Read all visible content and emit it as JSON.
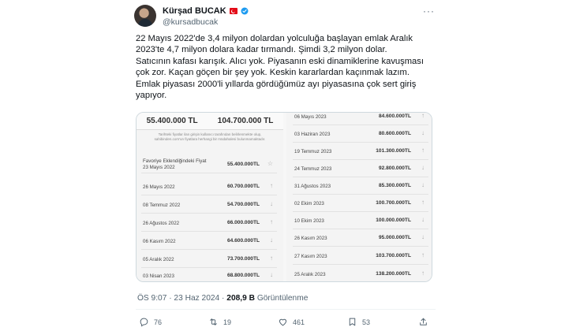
{
  "author": {
    "name": "Kürşad BUCAK",
    "handle": "@kursadbucak"
  },
  "tweet": {
    "lines": [
      "22 Mayıs 2022'de 3,4 milyon dolardan yolculuğa başlayan emlak Aralık",
      "2023'te 4,7 milyon dolara kadar tırmandı. Şimdi 3,2 milyon dolar.",
      "Satıcının kafası karışık. Alıcı yok. Piyasanın eski dinamiklerine kavuşması",
      "çok zor. Kaçan göçen bir şey yok. Keskin kararlardan kaçınmak lazım.",
      "Emlak piyasası 2000'li yıllarda gördüğümüz ayı piyasasına çok sert giriş",
      "yapıyor."
    ]
  },
  "media": {
    "left": {
      "price_current": "55.400.000 TL",
      "price_peak": "104.700.000 TL",
      "note": "Tarihteki fiyatlar ilan girişin kullanıcı tarafından belirlenmekte olup,\nsahibinden.com'un fiyatlara herhangi bir müdahalesi bulunmamaktadır.",
      "rows": [
        {
          "date": "Favoriye Eklendiğindeki Fiyat",
          "date2": "23 Mayıs 2022",
          "value": "55.400.000TL",
          "arrow": "☆"
        },
        {
          "date": "26 Mayıs 2022",
          "value": "60.700.000TL",
          "arrow": "↑"
        },
        {
          "date": "08 Temmuz 2022",
          "value": "54.700.000TL",
          "arrow": "↓"
        },
        {
          "date": "26 Ağustos 2022",
          "value": "66.000.000TL",
          "arrow": "↑"
        },
        {
          "date": "06 Kasım 2022",
          "value": "64.600.000TL",
          "arrow": "↓"
        },
        {
          "date": "05 Aralık 2022",
          "value": "73.700.000TL",
          "arrow": "↑"
        },
        {
          "date": "03 Nisan 2023",
          "value": "68.800.000TL",
          "arrow": "↓"
        }
      ]
    },
    "right": {
      "rows": [
        {
          "date": "06 Mayıs 2023",
          "value": "84.600.000TL",
          "arrow": "↑"
        },
        {
          "date": "03 Haziran 2023",
          "value": "80.600.000TL",
          "arrow": "↓"
        },
        {
          "date": "19 Temmuz 2023",
          "value": "101.300.000TL",
          "arrow": "↑"
        },
        {
          "date": "24 Temmuz 2023",
          "value": "92.800.000TL",
          "arrow": "↓"
        },
        {
          "date": "31 Ağustos 2023",
          "value": "85.300.000TL",
          "arrow": "↓"
        },
        {
          "date": "02 Ekim 2023",
          "value": "100.700.000TL",
          "arrow": "↑"
        },
        {
          "date": "10 Ekim 2023",
          "value": "100.000.000TL",
          "arrow": "↓"
        },
        {
          "date": "26 Kasım 2023",
          "value": "95.000.000TL",
          "arrow": "↓"
        },
        {
          "date": "27 Kasım 2023",
          "value": "103.700.000TL",
          "arrow": "↑"
        },
        {
          "date": "25 Aralık 2023",
          "value": "138.200.000TL",
          "arrow": "↑"
        }
      ]
    }
  },
  "meta": {
    "time": "ÖS 9:07 · 23 Haz 2024 ·",
    "views": "208,9 B",
    "views_label": "Görüntülenme"
  },
  "actions": {
    "replies": "76",
    "retweets": "19",
    "likes": "461",
    "bookmarks": "53"
  },
  "colors": {
    "secondary": "#536471",
    "verified": "#1d9bf0",
    "flag": "#e30a17"
  }
}
